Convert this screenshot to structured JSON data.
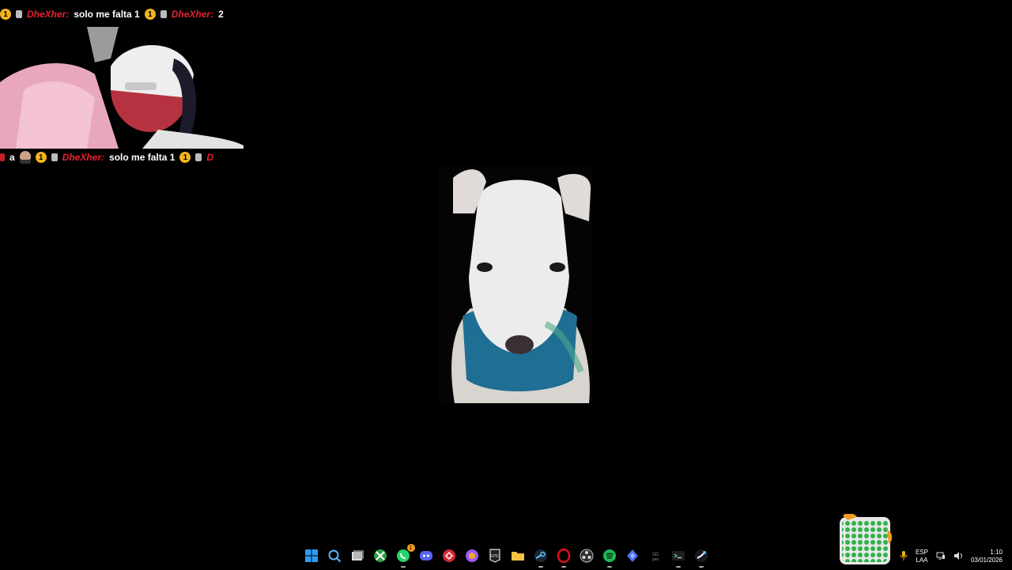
{
  "overlay": {
    "ticker_top": {
      "coin": "1",
      "badge": "8",
      "items": [
        {
          "author": "DheXher:",
          "message": "solo me falta 1"
        },
        {
          "author": "DheXher:",
          "message": "2"
        }
      ]
    },
    "ticker_bottom": {
      "prefix": "a",
      "coin": "1",
      "badge": "8",
      "items": [
        {
          "author": "DheXher:",
          "message": "solo me falta 1"
        },
        {
          "author": "D",
          "message": ""
        }
      ]
    }
  },
  "taskbar": {
    "icons": [
      "windows-start-icon",
      "search-icon",
      "task-view-icon",
      "xbox-icon",
      "whatsapp-icon",
      "discord-icon",
      "vpn-icon",
      "browser-icon",
      "epic-games-icon",
      "file-explorer-icon",
      "steam-icon",
      "opera-icon",
      "obs-icon",
      "spotify-icon",
      "cloud-icon",
      "xd-pen-icon",
      "terminal-icon",
      "steam-alt-icon"
    ],
    "whatsapp_badge": "1",
    "language_top": "ESP",
    "language_bottom": "LAA",
    "time": "1:10",
    "date": "03/01/2026"
  },
  "colors": {
    "author": "#e8232f",
    "coin": "#f3b51d",
    "background": "#000000",
    "spotify": "#1db954",
    "folder": "#f6c342"
  }
}
